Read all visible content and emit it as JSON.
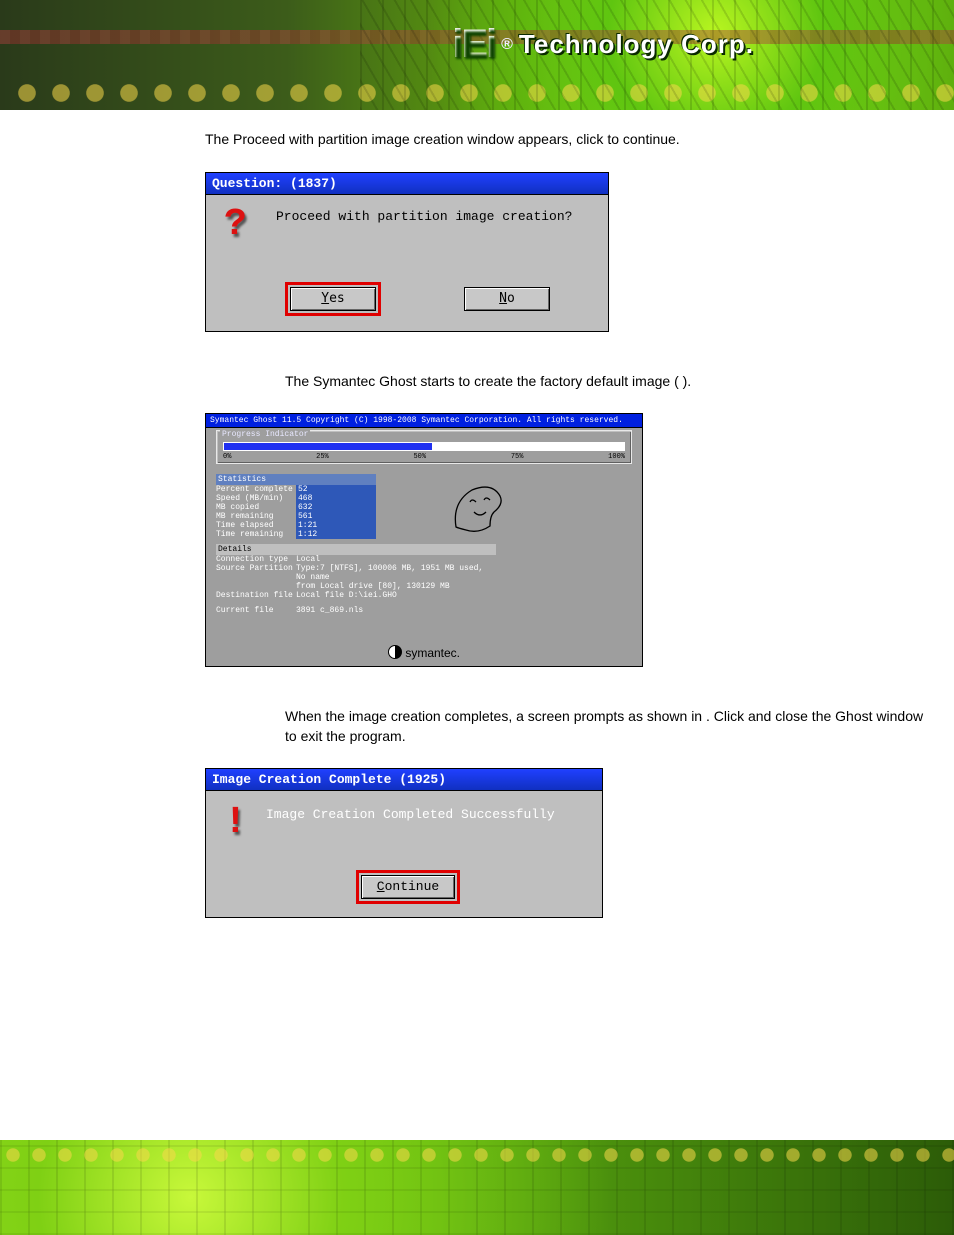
{
  "brand": {
    "name": "iEi",
    "reg": "®",
    "suffix": "Technology Corp."
  },
  "step11": {
    "pre": "The Proceed with partition image creation window appears, click ",
    "post": " to continue."
  },
  "dlg1": {
    "title": "Question: (1837)",
    "message": "Proceed with partition image creation?",
    "yes_pre": "Y",
    "yes_rest": "es",
    "no_pre": "N",
    "no_rest": "o"
  },
  "step12": {
    "pre": "The Symantec Ghost starts to create the factory default image (",
    "post": ")."
  },
  "chart_data": {
    "type": "table",
    "title": "Symantec Ghost 11.5   Copyright (C) 1998-2008 Symantec Corporation. All rights reserved.",
    "progress_label": "Progress Indicator",
    "scale": [
      "0%",
      "25%",
      "50%",
      "75%",
      "100%"
    ],
    "percent_complete": 52,
    "stats_header": "Statistics",
    "stats": [
      {
        "label": "Percent complete",
        "value": "52"
      },
      {
        "label": "Speed (MB/min)",
        "value": "468"
      },
      {
        "label": "MB copied",
        "value": "632"
      },
      {
        "label": "MB remaining",
        "value": "561"
      },
      {
        "label": "Time elapsed",
        "value": "1:21"
      },
      {
        "label": "Time remaining",
        "value": "1:12"
      }
    ],
    "details_header": "Details",
    "details": [
      {
        "label": "Connection type",
        "value": "Local"
      },
      {
        "label": "Source Partition",
        "value": "Type:7 [NTFS], 100006 MB, 1951 MB used, No name"
      },
      {
        "label": "",
        "value": "from Local drive [80], 130129 MB"
      },
      {
        "label": "Destination file",
        "value": "Local file D:\\iei.GHO"
      },
      {
        "label": "Current file",
        "value": "3891 c_869.nls"
      }
    ],
    "footer": "symantec."
  },
  "step13": {
    "pre": "When the image creation completes, a screen prompts as shown in ",
    "post": ". Click ",
    "post2": " and close the Ghost window to exit the program."
  },
  "dlg3": {
    "title": "Image Creation Complete (1925)",
    "message": "Image Creation Completed Successfully",
    "continue_pre": "C",
    "continue_rest": "ontinue"
  }
}
